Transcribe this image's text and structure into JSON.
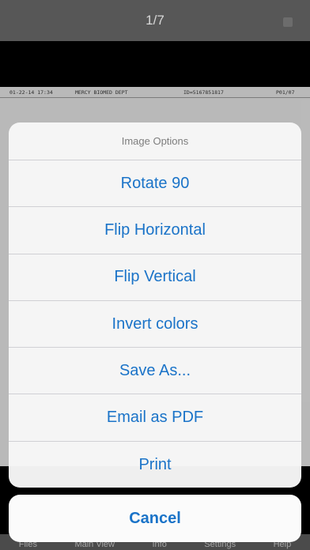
{
  "header": {
    "page_indicator": "1/7"
  },
  "document": {
    "header_fields": [
      "01-22-14 17:34",
      "MERCY BIOMED DEPT",
      "ID=5167851817",
      "P01/07"
    ]
  },
  "tabbar": {
    "items": [
      "Files",
      "Main View",
      "Info",
      "Settings",
      "Help"
    ]
  },
  "action_sheet": {
    "title": "Image Options",
    "options": [
      "Rotate 90",
      "Flip Horizontal",
      "Flip Vertical",
      "Invert colors",
      "Save As...",
      "Email as PDF",
      "Print"
    ],
    "cancel_label": "Cancel"
  },
  "colors": {
    "accent": "#1a73c8",
    "topbar": "#575757"
  }
}
